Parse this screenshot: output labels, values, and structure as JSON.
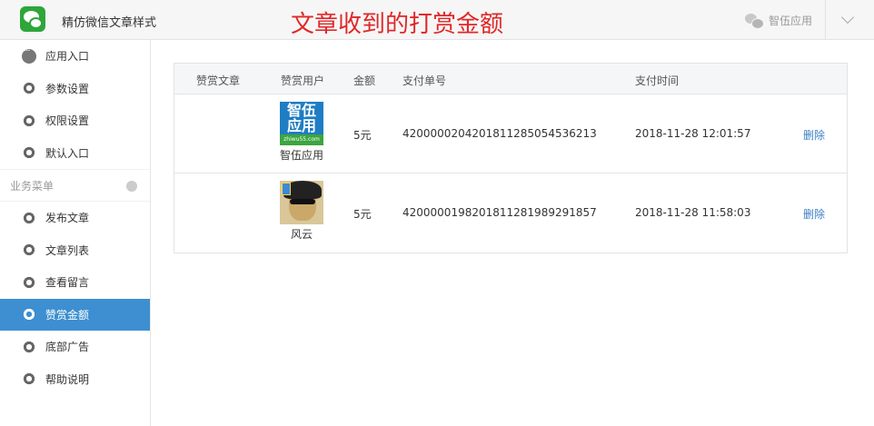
{
  "header": {
    "app_title": "精仿微信文章样式",
    "banner": "文章收到的打赏金额",
    "user_name": "智伍应用"
  },
  "sidebar": {
    "items_top": [
      {
        "label": "应用入口",
        "icon": "chat-icon"
      },
      {
        "label": "参数设置",
        "icon": "gear-icon"
      },
      {
        "label": "权限设置",
        "icon": "gear-icon"
      },
      {
        "label": "默认入口",
        "icon": "gear-icon"
      }
    ],
    "section_label": "业务菜单",
    "items_business": [
      {
        "label": "发布文章",
        "icon": "gear-icon"
      },
      {
        "label": "文章列表",
        "icon": "gear-icon"
      },
      {
        "label": "查看留言",
        "icon": "gear-icon"
      },
      {
        "label": "赞赏金额",
        "icon": "gear-icon",
        "active": true
      },
      {
        "label": "底部广告",
        "icon": "gear-icon"
      },
      {
        "label": "帮助说明",
        "icon": "gear-icon"
      }
    ]
  },
  "table": {
    "columns": [
      "赞赏文章",
      "赞赏用户",
      "金额",
      "支付单号",
      "支付时间"
    ],
    "rows": [
      {
        "article": "",
        "user": "智伍应用",
        "avatar_text_top": "智伍\n应用",
        "avatar_text_bottom": "zhiwu55.com",
        "amount": "5元",
        "order_no": "4200000204201811285054536213",
        "time": "2018-11-28 12:01:57",
        "action": "删除"
      },
      {
        "article": "",
        "user": "风云",
        "amount": "5元",
        "order_no": "4200000198201811281989291857",
        "time": "2018-11-28 11:58:03",
        "action": "删除"
      }
    ]
  },
  "colors": {
    "accent": "#3d8fd1",
    "banner": "#e02828",
    "link": "#3d7fc4"
  }
}
